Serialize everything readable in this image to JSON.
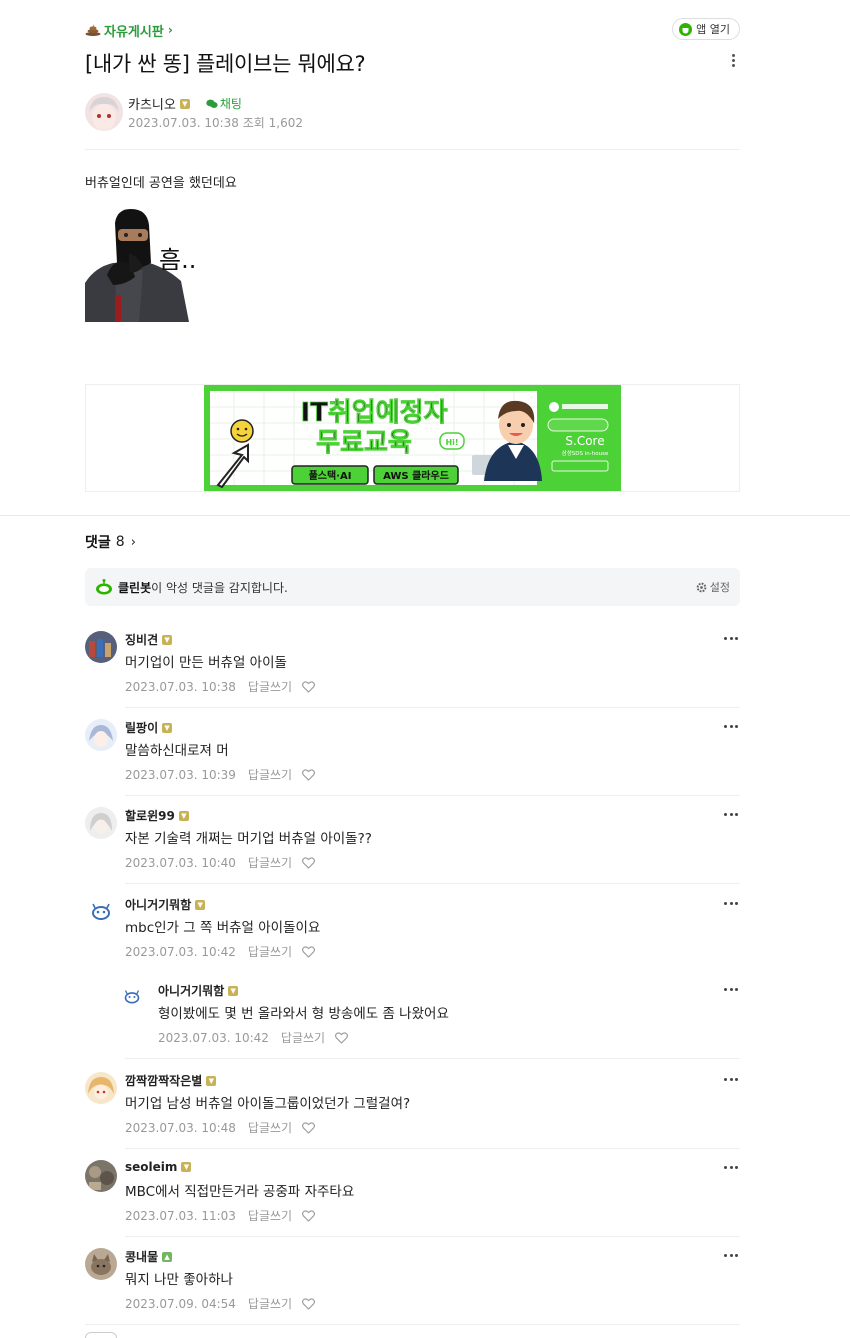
{
  "header": {
    "board_name": "자유게시판",
    "app_open_label": "앱 열기",
    "title": "[내가 싼 똥] 플레이브는 뭐에요?"
  },
  "author": {
    "name": "카츠니오",
    "chat_label": "채팅",
    "date": "2023.07.03. 10:38",
    "views_label": "조회 1,602"
  },
  "post": {
    "body": "버츄얼인데 공연을 했던데요",
    "meme_text": "흠.."
  },
  "ad": {
    "headline_1": "IT취업예정자",
    "headline_2": "무료교육",
    "tag_1": "풀스택·AI",
    "tag_2": "AWS 클라우드",
    "brand": "S.Core",
    "brand_sub": "삼성SDS in-house",
    "bubble": "Hi!"
  },
  "comments_header": {
    "label": "댓글",
    "count": "8"
  },
  "cleanbot": {
    "name": "클린봇",
    "text": "이 악성 댓글을 감지합니다.",
    "settings_label": "설정"
  },
  "comment_actions": {
    "reply_label": "답글쓰기"
  },
  "comments": [
    {
      "name": "징비견",
      "text": "머기업이 만든 버츄얼 아이돌",
      "date": "2023.07.03. 10:38"
    },
    {
      "name": "릴팡이",
      "text": "말씀하신대로져 머",
      "date": "2023.07.03. 10:39"
    },
    {
      "name": "할로윈99",
      "text": "자본 기술력 개쩌는 머기업 버츄얼 아이돌??",
      "date": "2023.07.03. 10:40"
    },
    {
      "name": "아니거기뭐함",
      "text": "mbc인가 그 쪽 버츄얼 아이돌이요",
      "date": "2023.07.03. 10:42"
    },
    {
      "name": "아니거기뭐함",
      "text": "형이봤에도 몇 번 올라와서 형 방송에도 좀 나왔어요",
      "date": "2023.07.03. 10:42"
    },
    {
      "name": "깜짝깜짝작은별",
      "text": "머기업 남성 버츄얼 아이돌그룹이었던가 그럴걸여?",
      "date": "2023.07.03. 10:48"
    },
    {
      "name": "seoleim",
      "text": "MBC에서 직접만든거라 공중파 자주타요",
      "date": "2023.07.03. 11:03"
    },
    {
      "name": "콩내물",
      "text": "뭐지 나만 좋아하나",
      "date": "2023.07.09. 04:54"
    }
  ],
  "colors": {
    "accent_green": "#2a9d3a",
    "ad_green": "#4cd137",
    "meta_gray": "#999999"
  }
}
